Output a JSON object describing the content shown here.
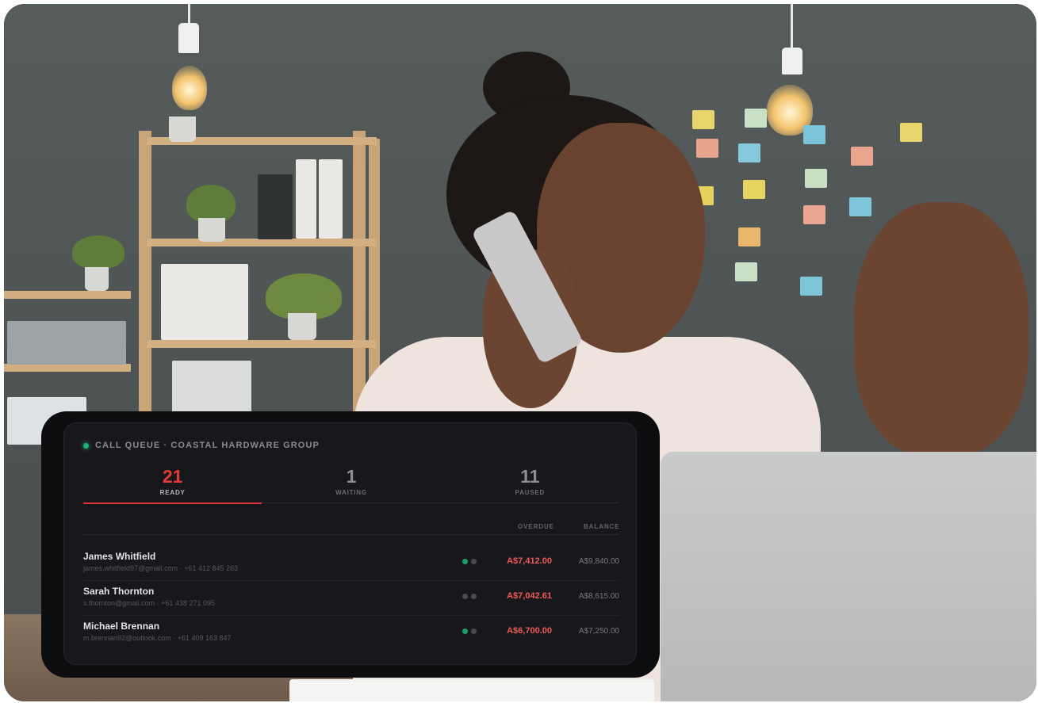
{
  "queue": {
    "title": "CALL QUEUE · COASTAL HARDWARE GROUP",
    "status_color": "#1fb077",
    "tabs": [
      {
        "count": "21",
        "label": "READY",
        "active": true
      },
      {
        "count": "1",
        "label": "WAITING",
        "active": false
      },
      {
        "count": "11",
        "label": "PAUSED",
        "active": false
      }
    ],
    "columns": {
      "overdue": "OVERDUE",
      "balance": "BALANCE"
    },
    "rows": [
      {
        "name": "James Whitfield",
        "contact": "james.whitfield97@gmail.com · +61 412 845 263",
        "overdue": "A$7,412.00",
        "balance": "A$9,840.00",
        "status": [
          "green",
          "grey"
        ]
      },
      {
        "name": "Sarah Thornton",
        "contact": "s.thornton@gmail.com · +61 438 271 095",
        "overdue": "A$7,042.61",
        "balance": "A$8,615.00",
        "status": [
          "grey",
          "grey"
        ]
      },
      {
        "name": "Michael Brennan",
        "contact": "m.brennan92@outlook.com · +61 409 163 847",
        "overdue": "A$6,700.00",
        "balance": "A$7,250.00",
        "status": [
          "green",
          "grey"
        ]
      }
    ]
  },
  "colors": {
    "accent_red": "#e03a3a",
    "overdue_red": "#ef5a5a",
    "online_green": "#1fa06b"
  }
}
